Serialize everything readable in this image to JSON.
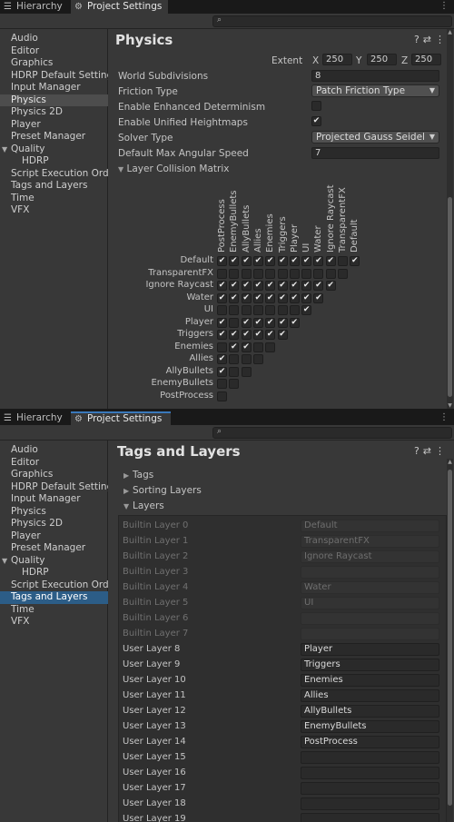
{
  "panel1": {
    "tabs": [
      {
        "label": "Hierarchy",
        "icon": "list-icon"
      },
      {
        "label": "Project Settings",
        "icon": "gear-icon"
      }
    ],
    "title": "Physics",
    "sidebar": [
      "Audio",
      "Editor",
      "Graphics",
      "HDRP Default Settings",
      "Input Manager",
      "Physics",
      "Physics 2D",
      "Player",
      "Preset Manager",
      "Quality",
      "HDRP",
      "Script Execution Order",
      "Tags and Layers",
      "Time",
      "VFX"
    ],
    "selected": "Physics",
    "extent": {
      "label": "Extent",
      "x_label": "X",
      "x": "250",
      "y_label": "Y",
      "y": "250",
      "z_label": "Z",
      "z": "250"
    },
    "props": {
      "world_subdivisions": {
        "label": "World Subdivisions",
        "value": "8"
      },
      "friction_type": {
        "label": "Friction Type",
        "value": "Patch Friction Type"
      },
      "enhanced_determinism": {
        "label": "Enable Enhanced Determinism",
        "checked": false
      },
      "unified_heightmaps": {
        "label": "Enable Unified Heightmaps",
        "checked": true
      },
      "solver_type": {
        "label": "Solver Type",
        "value": "Projected Gauss Seidel"
      },
      "max_angular_speed": {
        "label": "Default Max Angular Speed",
        "value": "7"
      }
    },
    "matrix": {
      "label": "Layer Collision Matrix",
      "columns": [
        "PostProcess",
        "EnemyBullets",
        "AllyBullets",
        "Allies",
        "Enemies",
        "Triggers",
        "Player",
        "UI",
        "Water",
        "Ignore Raycast",
        "TransparentFX",
        "Default"
      ],
      "rows": [
        {
          "name": "Default",
          "checks": [
            1,
            1,
            1,
            1,
            1,
            1,
            1,
            1,
            1,
            1,
            0,
            1
          ]
        },
        {
          "name": "TransparentFX",
          "checks": [
            0,
            0,
            0,
            0,
            0,
            0,
            0,
            0,
            0,
            0,
            0
          ]
        },
        {
          "name": "Ignore Raycast",
          "checks": [
            1,
            1,
            1,
            1,
            1,
            1,
            1,
            1,
            1,
            1
          ]
        },
        {
          "name": "Water",
          "checks": [
            1,
            1,
            1,
            1,
            1,
            1,
            1,
            1,
            1
          ]
        },
        {
          "name": "UI",
          "checks": [
            0,
            0,
            0,
            0,
            0,
            0,
            0,
            1
          ]
        },
        {
          "name": "Player",
          "checks": [
            1,
            0,
            1,
            1,
            1,
            1,
            1
          ]
        },
        {
          "name": "Triggers",
          "checks": [
            1,
            1,
            1,
            1,
            1,
            1
          ]
        },
        {
          "name": "Enemies",
          "checks": [
            0,
            1,
            1,
            0,
            0
          ]
        },
        {
          "name": "Allies",
          "checks": [
            1,
            0,
            0,
            0
          ]
        },
        {
          "name": "AllyBullets",
          "checks": [
            1,
            0,
            0
          ]
        },
        {
          "name": "EnemyBullets",
          "checks": [
            0,
            0
          ]
        },
        {
          "name": "PostProcess",
          "checks": [
            0
          ]
        }
      ]
    }
  },
  "panel2": {
    "tabs": [
      {
        "label": "Hierarchy",
        "icon": "list-icon"
      },
      {
        "label": "Project Settings",
        "icon": "gear-icon"
      }
    ],
    "title": "Tags and Layers",
    "sidebar": [
      "Audio",
      "Editor",
      "Graphics",
      "HDRP Default Settings",
      "Input Manager",
      "Physics",
      "Physics 2D",
      "Player",
      "Preset Manager",
      "Quality",
      "HDRP",
      "Script Execution Order",
      "Tags and Layers",
      "Time",
      "VFX"
    ],
    "selected": "Tags and Layers",
    "sections": {
      "tags": "Tags",
      "sorting": "Sorting Layers",
      "layers": "Layers"
    },
    "layers": [
      {
        "label": "Builtin Layer 0",
        "value": "Default",
        "builtin": true
      },
      {
        "label": "Builtin Layer 1",
        "value": "TransparentFX",
        "builtin": true
      },
      {
        "label": "Builtin Layer 2",
        "value": "Ignore Raycast",
        "builtin": true
      },
      {
        "label": "Builtin Layer 3",
        "value": "",
        "builtin": true
      },
      {
        "label": "Builtin Layer 4",
        "value": "Water",
        "builtin": true
      },
      {
        "label": "Builtin Layer 5",
        "value": "UI",
        "builtin": true
      },
      {
        "label": "Builtin Layer 6",
        "value": "",
        "builtin": true
      },
      {
        "label": "Builtin Layer 7",
        "value": "",
        "builtin": true
      },
      {
        "label": "User Layer 8",
        "value": "Player",
        "builtin": false
      },
      {
        "label": "User Layer 9",
        "value": "Triggers",
        "builtin": false
      },
      {
        "label": "User Layer 10",
        "value": "Enemies",
        "builtin": false
      },
      {
        "label": "User Layer 11",
        "value": "Allies",
        "builtin": false
      },
      {
        "label": "User Layer 12",
        "value": "AllyBullets",
        "builtin": false
      },
      {
        "label": "User Layer 13",
        "value": "EnemyBullets",
        "builtin": false
      },
      {
        "label": "User Layer 14",
        "value": "PostProcess",
        "builtin": false
      },
      {
        "label": "User Layer 15",
        "value": "",
        "builtin": false
      },
      {
        "label": "User Layer 16",
        "value": "",
        "builtin": false
      },
      {
        "label": "User Layer 17",
        "value": "",
        "builtin": false
      },
      {
        "label": "User Layer 18",
        "value": "",
        "builtin": false
      },
      {
        "label": "User Layer 19",
        "value": "",
        "builtin": false
      }
    ]
  },
  "colors": {
    "selection_blue": "#2c5d87",
    "tab_accent": "#3a79bb"
  },
  "header_icons": [
    "help-icon",
    "preset-icon",
    "menu-icon"
  ],
  "checkmark": "✔"
}
